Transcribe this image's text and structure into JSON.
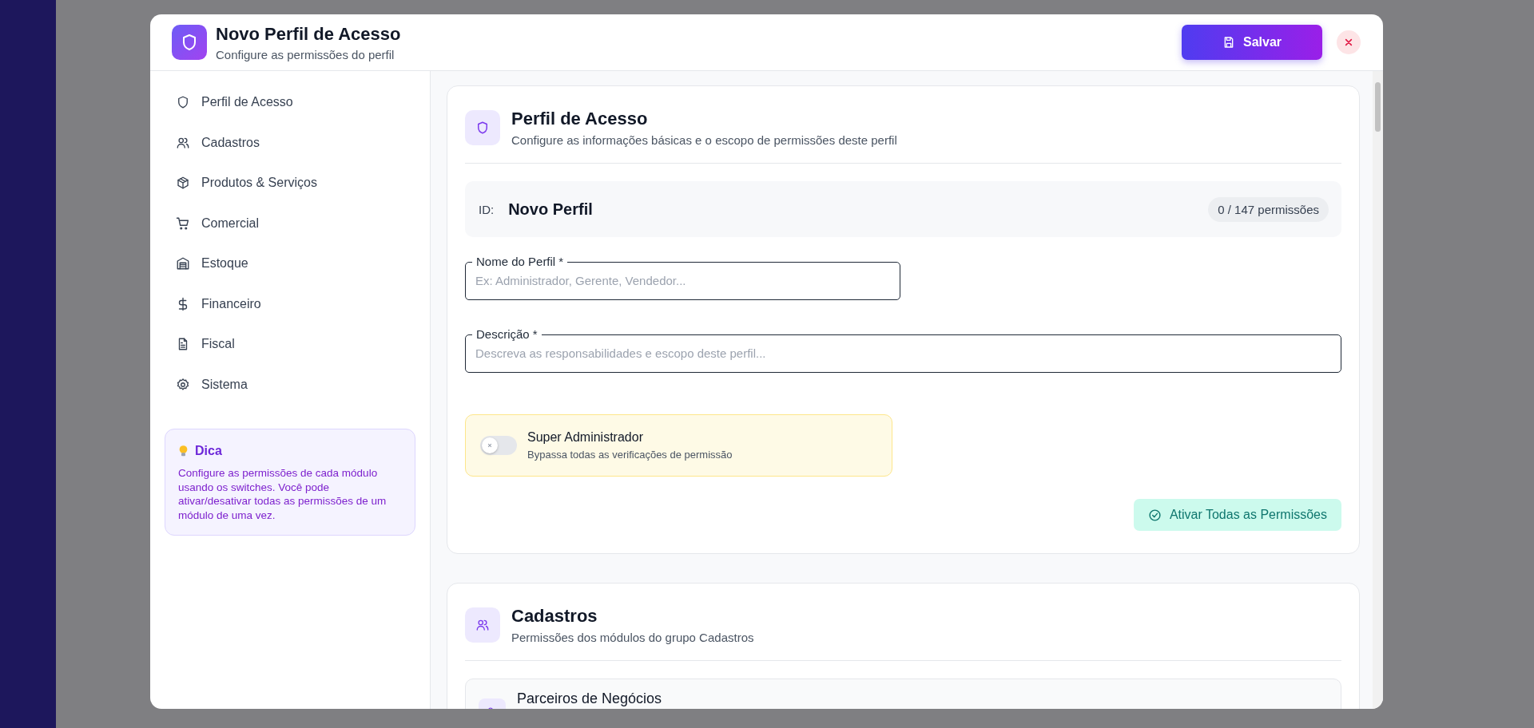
{
  "modal": {
    "title": "Novo Perfil de Acesso",
    "subtitle": "Configure as permissões do perfil",
    "save_button": "Salvar"
  },
  "sidebar": {
    "items": [
      {
        "label": "Perfil de Acesso"
      },
      {
        "label": "Cadastros"
      },
      {
        "label": "Produtos & Serviços"
      },
      {
        "label": "Comercial"
      },
      {
        "label": "Estoque"
      },
      {
        "label": "Financeiro"
      },
      {
        "label": "Fiscal"
      },
      {
        "label": "Sistema"
      }
    ],
    "tip": {
      "title": "Dica",
      "text": "Configure as permissões de cada módulo usando os switches. Você pode ativar/desativar todas as permissões de um módulo de uma vez."
    }
  },
  "profile_section": {
    "title": "Perfil de Acesso",
    "subtitle": "Configure as informações básicas e o escopo de permissões deste perfil",
    "id_label": "ID:",
    "profile_name": "Novo Perfil",
    "permission_count": "0 / 147 permissões",
    "fields": [
      {
        "label": "Nome do Perfil *",
        "placeholder": "Ex: Administrador, Gerente, Vendedor..."
      },
      {
        "label": "Descrição *",
        "placeholder": "Descreva as responsabilidades e escopo deste perfil..."
      }
    ],
    "super_admin": {
      "title": "Super Administrador",
      "description": "Bypassa todas as verificações de permissão",
      "on": false
    },
    "action_button": "Ativar Todas as Permissões"
  },
  "cadastros_section": {
    "title": "Cadastros",
    "subtitle": "Permissões dos módulos do grupo Cadastros",
    "modules": [
      {
        "name": "Parceiros de Negócios"
      }
    ]
  }
}
